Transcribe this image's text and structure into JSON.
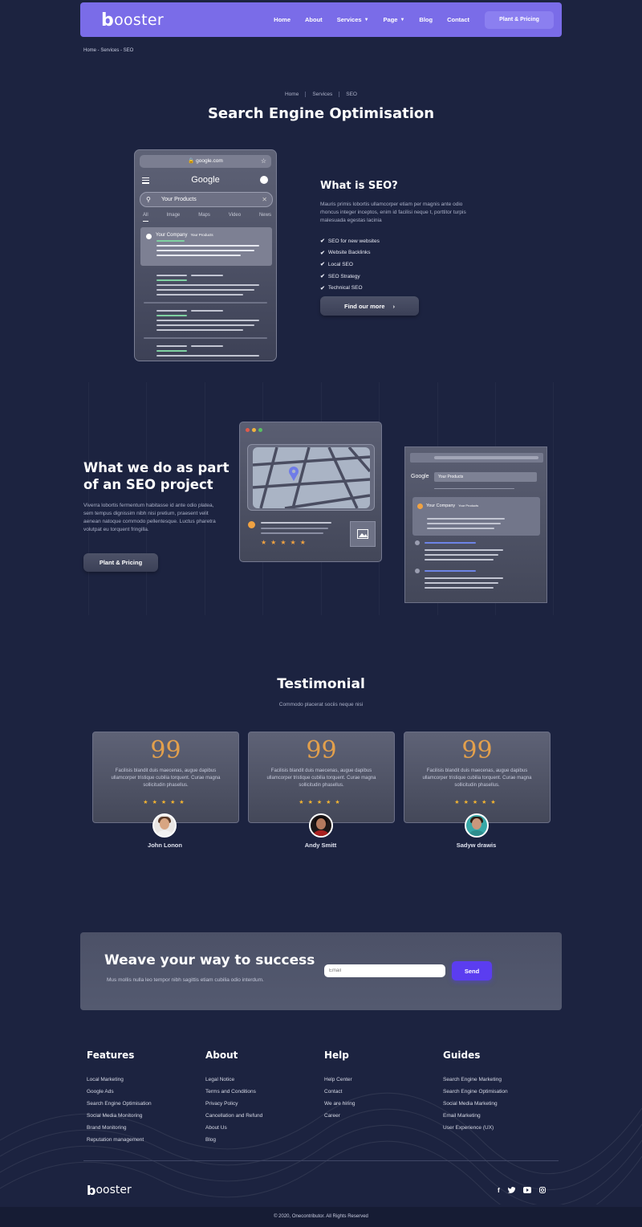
{
  "brand": {
    "logo_b": "b",
    "logo_rest": "ooster"
  },
  "nav": {
    "items": [
      {
        "label": "Home",
        "has_chevron": false
      },
      {
        "label": "About",
        "has_chevron": false
      },
      {
        "label": "Services",
        "has_chevron": true
      },
      {
        "label": "Page",
        "has_chevron": true
      },
      {
        "label": "Blog",
        "has_chevron": false
      },
      {
        "label": "Contact",
        "has_chevron": false
      }
    ],
    "cta": "Plant & Pricing"
  },
  "top_breadcrumb": "Home - Services - SEO",
  "breadcrumb": [
    "Home",
    "Services",
    "SEO"
  ],
  "page_title": "Search Engine Optimisation",
  "phone_mock": {
    "url": "google.com",
    "logo": "Google",
    "search_text": "Your Products",
    "tabs": [
      "All",
      "Image",
      "Maps",
      "Video",
      "News"
    ],
    "result_company": "Your Company",
    "result_product": "Your Products"
  },
  "what_is_seo": {
    "heading": "What is SEO?",
    "paragraph": "Mauris primis lobortis ullamcorper etiam per magnis ante odio rhoncus integer inceptos, enim id facilisi neque t, porttitor turpis malesuada egestas lacinia",
    "list": [
      "SEO for new websites",
      "Website Backlinks",
      "Local SEO",
      "SEO Strategy",
      "Technical SEO"
    ],
    "button": "Find our more"
  },
  "seo_project": {
    "heading_line1": "What we do as part",
    "heading_line2": "of an SEO project",
    "paragraph": "Viverra lobortis fermentum habitasse id ante odio platea, sem tempus dignissim nibh nisi pretium, praesent velit aenean natoque commodo pellentesque. Luctus pharetra volutpat eu torquent fringilla.",
    "button": "Plant & Pricing",
    "map_rating_stars": "★★★★★",
    "google_window": {
      "logo": "Google",
      "search": "Your Products",
      "company": "Your Company",
      "product": "Your Products"
    }
  },
  "testimonial": {
    "heading": "Testimonial",
    "subheading": "Commodo placerat sociis neque nisi",
    "cards": [
      {
        "text": "Facilisis blandit duis maecenas, augue dapibus ullamcorper tristique cubilia torquent. Curae magna sollicitudin phasellus.",
        "stars": "★★★★★",
        "name": "John Lonon"
      },
      {
        "text": "Facilisis blandit duis maecenas, augue dapibus ullamcorper tristique cubilia torquent. Curae magna sollicitudin phasellus.",
        "stars": "★★★★★",
        "name": "Andy Smitt"
      },
      {
        "text": "Facilisis blandit duis maecenas, augue dapibus ullamcorper tristique cubilia torquent. Curae magna sollicitudin phasellus.",
        "stars": "★★★★★",
        "name": "Sadyw drawis"
      }
    ],
    "quote_glyph": "99"
  },
  "newsletter": {
    "heading": "Weave your way to success",
    "paragraph": "Mus mollis nulla leo tempor nibh sagittis etiam cubilia odio interdum.",
    "email_placeholder": "Email",
    "send": "Send"
  },
  "footer": {
    "columns": [
      {
        "title": "Features",
        "links": [
          "Local Marketing",
          "Google Ads",
          "Search Engine Optimisation",
          "Social Media Monitoring",
          "Brand Monitoring",
          "Reputation management"
        ]
      },
      {
        "title": "About",
        "links": [
          "Legal Notice",
          "Terms and Conditions",
          "Privacy Policy",
          "Cancellation and Refund",
          "About Us",
          "Blog"
        ]
      },
      {
        "title": "Help",
        "links": [
          "Help Center",
          "Contact",
          "We are hiring",
          "Career"
        ]
      },
      {
        "title": "Guides",
        "links": [
          "Search Engine Marketing",
          "Search Engine Optimisation",
          "Social Media Marketing",
          "Email Marketing",
          "User Experience (UX)"
        ]
      }
    ],
    "social_icons": [
      "facebook-icon",
      "twitter-icon",
      "youtube-icon",
      "instagram-icon"
    ],
    "copyright": "© 2020, Onecontributor. All Rights Reserved"
  },
  "colors": {
    "background": "#1c2340",
    "nav": "#7a6ce8",
    "accent_orange": "#f0a242",
    "send_button": "#5b3df0",
    "star": "#f3b431"
  }
}
